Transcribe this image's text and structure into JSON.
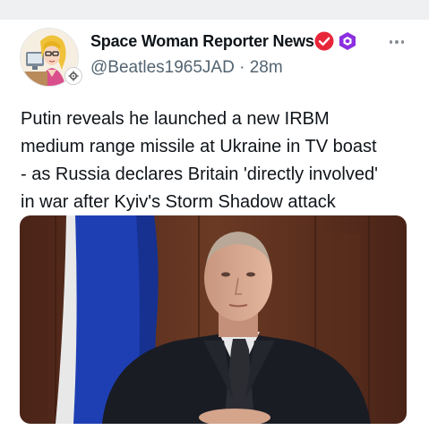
{
  "post": {
    "author": {
      "display_name": "Space Woman Reporter News",
      "handle": "@Beatles1965JAD",
      "time_ago": "28m"
    },
    "separator": "·",
    "text": "Putin reveals he launched a new IRBM\nmedium range missile at Ukraine in TV boast\n- as Russia declares Britain 'directly involved'\nin war after Kyiv's Storm Shadow attack",
    "icons": {
      "verified": "verified-check-icon",
      "extra_badge": "purple-hexagon-badge-icon",
      "more": "more-options-icon",
      "avatar_badge": "gear-badge-icon"
    }
  },
  "colors": {
    "verified_badge": "#e8263a",
    "purple_badge": "#8b2fe0",
    "handle_gray": "#536471",
    "flag_blue": "#1e3fb4"
  }
}
